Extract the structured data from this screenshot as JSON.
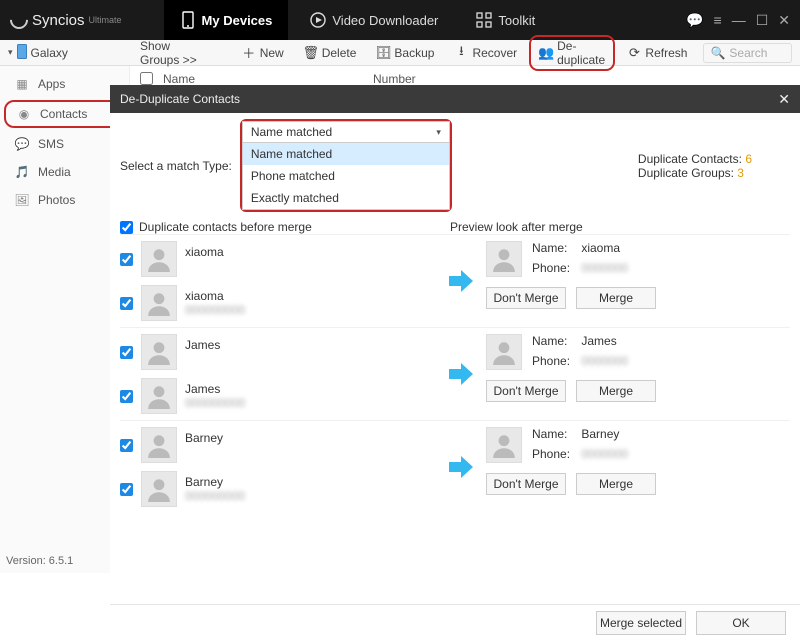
{
  "app": {
    "brand": "Syncios",
    "edition": "Ultimate"
  },
  "top_tabs": {
    "my_devices": "My Devices",
    "video_downloader": "Video Downloader",
    "toolkit": "Toolkit"
  },
  "toolbar": {
    "device": "Galaxy",
    "show_groups": "Show Groups >>",
    "new": "New",
    "delete": "Delete",
    "backup": "Backup",
    "recover": "Recover",
    "deduplicate": "De-duplicate",
    "refresh": "Refresh",
    "search_placeholder": "Search"
  },
  "sidebar": {
    "apps": "Apps",
    "contacts": "Contacts",
    "sms": "SMS",
    "media": "Media",
    "photos": "Photos"
  },
  "columns": {
    "name": "Name",
    "number": "Number"
  },
  "dialog": {
    "title": "De-Duplicate Contacts",
    "select_match_label": "Select a match Type:",
    "match_selected": "Name matched",
    "match_options": {
      "name": "Name matched",
      "phone": "Phone matched",
      "exact": "Exactly matched"
    },
    "dup_contacts_label": "Duplicate Contacts:",
    "dup_contacts_n": "6",
    "dup_groups_label": "Duplicate Groups:",
    "dup_groups_n": "3",
    "before_label": "Duplicate contacts before merge",
    "after_label": "Preview look after merge",
    "name_label": "Name:",
    "phone_label": "Phone:",
    "dont_merge": "Don't Merge",
    "merge": "Merge",
    "merge_selected": "Merge selected",
    "ok": "OK",
    "groups": [
      {
        "a": "xiaoma",
        "b": "xiaoma",
        "merged": "xiaoma",
        "phone": ""
      },
      {
        "a": "James",
        "b": "James",
        "merged": "James",
        "phone": ""
      },
      {
        "a": "Barney",
        "b": "Barney",
        "merged": "Barney",
        "phone": ""
      }
    ]
  },
  "footer": {
    "version": "Version: 6.5.1"
  }
}
